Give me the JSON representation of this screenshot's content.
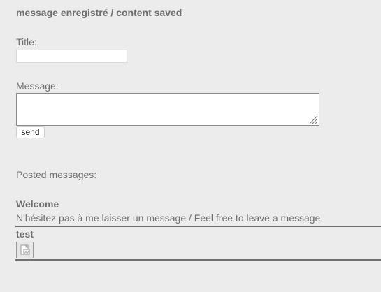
{
  "status": {
    "text": "message enregistré / content saved"
  },
  "form": {
    "title_label": "Title:",
    "title_value": "",
    "message_label": "Message:",
    "message_value": "",
    "send_label": "send"
  },
  "posts": {
    "heading": "Posted messages:",
    "items": [
      {
        "title": "Welcome",
        "body": "N'hésitez pas à me laisser un message / Feel free to leave a message"
      },
      {
        "title": "test",
        "body": "",
        "attachment_icon": "broken-image-icon"
      }
    ]
  },
  "colors": {
    "background": "#ececec",
    "text": "#6f6f6f",
    "divider": "#6f6f6f",
    "input_background": "#ffffff"
  }
}
